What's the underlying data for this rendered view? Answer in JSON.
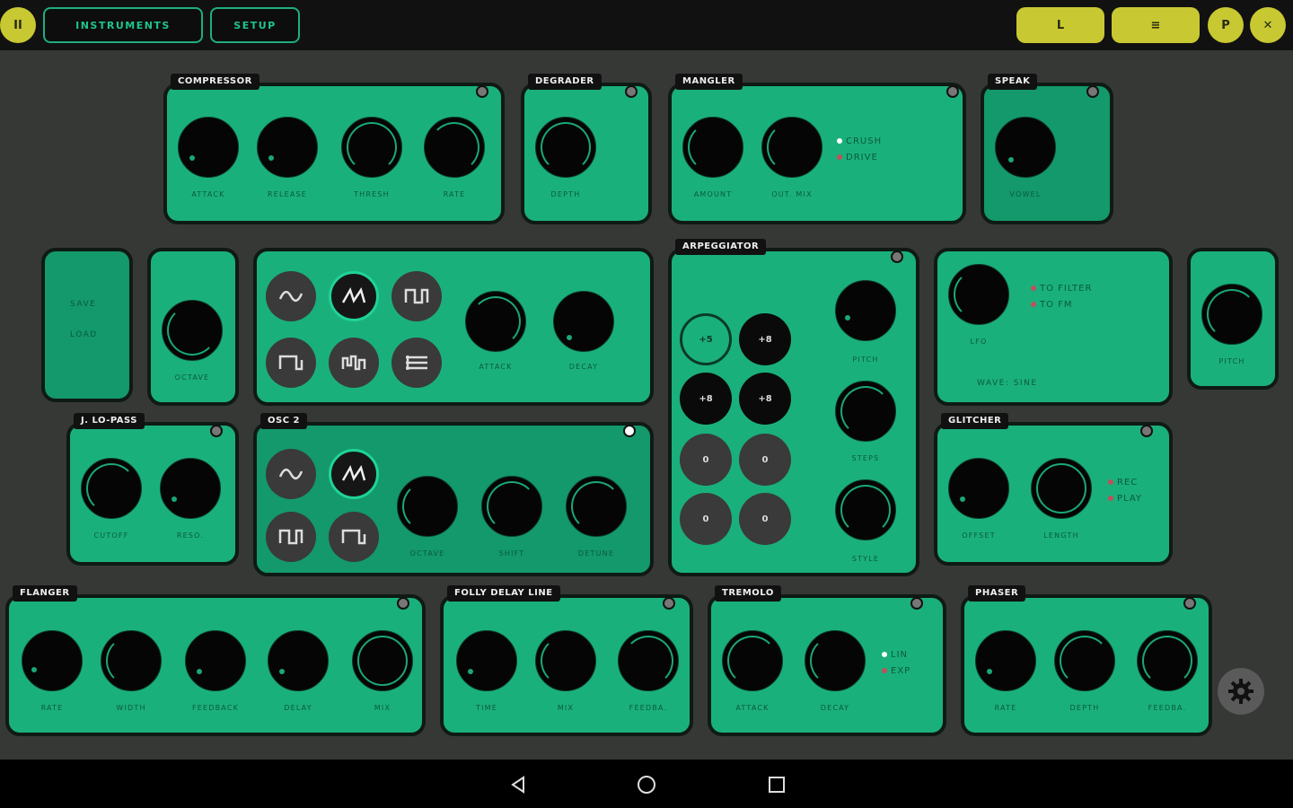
{
  "topbar": {
    "pause_label": "II",
    "instruments_label": "INSTRUMENTS",
    "setup_label": "SETUP",
    "btn_l_label": "L",
    "btn_menu_label": "≡",
    "btn_p_label": "P",
    "btn_close_label": "✕"
  },
  "colors": {
    "panel": "#1ab07c",
    "panel_dark": "#13996b",
    "accent": "#c8c832",
    "knob": "#050505",
    "border": "#0f1a14"
  },
  "compressor": {
    "title": "COMPRESSOR",
    "knobs": [
      "ATTACK",
      "RELEASE",
      "THRESH",
      "RATE"
    ]
  },
  "degrader": {
    "title": "DEGRADER",
    "knobs": [
      "DEPTH"
    ]
  },
  "mangler": {
    "title": "MANGLER",
    "knobs": [
      "AMOUNT",
      "OUT. MIX"
    ],
    "options": [
      "CRUSH",
      "DRIVE"
    ]
  },
  "speak": {
    "title": "SPEAK",
    "knobs": [
      "VOWEL"
    ]
  },
  "saveload": {
    "save": "SAVE",
    "load": "LOAD"
  },
  "octave_panel": {
    "knobs": [
      "OCTAVE"
    ]
  },
  "osc1": {
    "knobs": [
      "ATTACK",
      "DECAY"
    ]
  },
  "arpeggiator": {
    "title": "ARPEGGIATOR",
    "steps": [
      "+5",
      "+8",
      "+8",
      "+8",
      "0",
      "0",
      "0",
      "0"
    ],
    "knobs": [
      "PITCH",
      "STEPS",
      "STYLE"
    ]
  },
  "lfo": {
    "knobs": [
      "LFO"
    ],
    "options": [
      "TO FILTER",
      "TO FM"
    ],
    "wave_label": "WAVE: SINE"
  },
  "pitch_panel": {
    "knobs": [
      "PITCH"
    ]
  },
  "lopass": {
    "title": "J. LO-PASS",
    "knobs": [
      "CUTOFF",
      "RESO."
    ]
  },
  "osc2": {
    "title": "OSC 2",
    "knobs": [
      "OCTAVE",
      "SHIFT",
      "DETUNE"
    ]
  },
  "glitcher": {
    "title": "GLITCHER",
    "knobs": [
      "OFFSET",
      "LENGTH"
    ],
    "options": [
      "REC",
      "PLAY"
    ]
  },
  "flanger": {
    "title": "FLANGER",
    "knobs": [
      "RATE",
      "WIDTH",
      "FEEDBACK",
      "DELAY",
      "MIX"
    ]
  },
  "delay": {
    "title": "FOLLY DELAY LINE",
    "knobs": [
      "TIME",
      "MIX",
      "FEEDBA."
    ]
  },
  "tremolo": {
    "title": "TREMOLO",
    "knobs": [
      "ATTACK",
      "DECAY"
    ],
    "options": [
      "LIN",
      "EXP"
    ]
  },
  "phaser": {
    "title": "PHASER",
    "knobs": [
      "RATE",
      "DEPTH",
      "FEEDBA."
    ]
  }
}
